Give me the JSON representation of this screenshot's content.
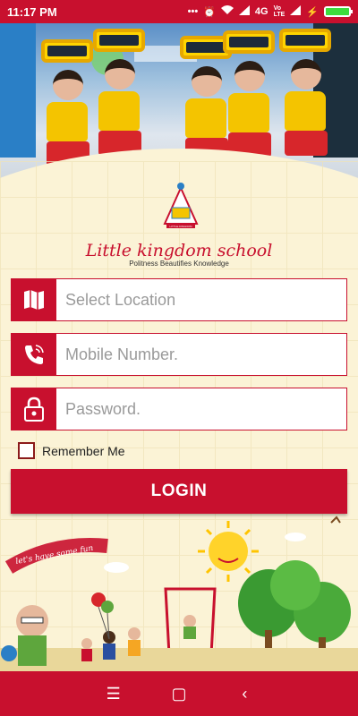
{
  "status_bar": {
    "time": "11:17 PM",
    "network": "4G",
    "icons": [
      "more-icon",
      "alarm-icon",
      "wifi-icon",
      "signal-icon",
      "volte-icon",
      "signal-icon",
      "charging-icon",
      "battery-icon"
    ],
    "battery_level": 1.0
  },
  "brand": {
    "logo_text": "LITTLE KINGDOM",
    "school_name": "Little kingdom school",
    "tagline": "Politness Beautifies Knowledge"
  },
  "form": {
    "location_placeholder": "Select Location",
    "mobile_placeholder": "Mobile Number.",
    "password_placeholder": "Password.",
    "remember_label": "Remember Me",
    "login_label": "LOGIN"
  },
  "illustration": {
    "banner_text": "let's have some fun"
  },
  "nav": {
    "icons": [
      "menu-icon",
      "home-icon",
      "back-icon"
    ]
  },
  "colors": {
    "primary": "#c8102e",
    "background": "#fbf3d6"
  }
}
